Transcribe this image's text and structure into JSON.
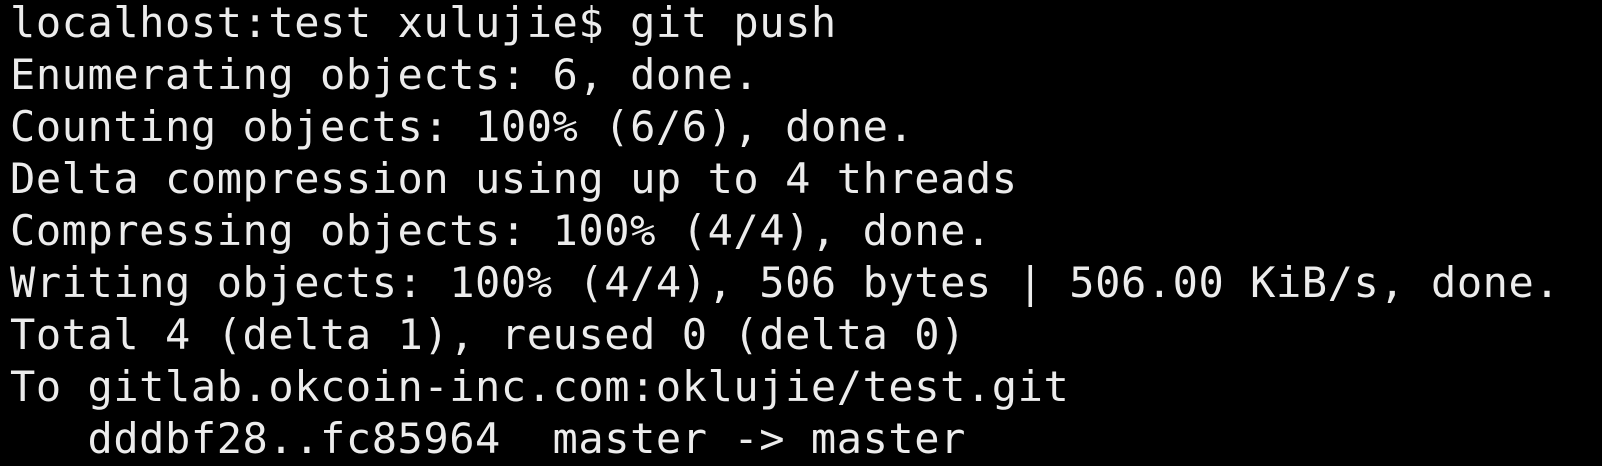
{
  "terminal": {
    "lines": [
      "localhost:test xulujie$ git push",
      "Enumerating objects: 6, done.",
      "Counting objects: 100% (6/6), done.",
      "Delta compression using up to 4 threads",
      "Compressing objects: 100% (4/4), done.",
      "Writing objects: 100% (4/4), 506 bytes | 506.00 KiB/s, done.",
      "Total 4 (delta 1), reused 0 (delta 0)",
      "To gitlab.okcoin-inc.com:oklujie/test.git",
      "   dddbf28..fc85964  master -> master"
    ]
  }
}
